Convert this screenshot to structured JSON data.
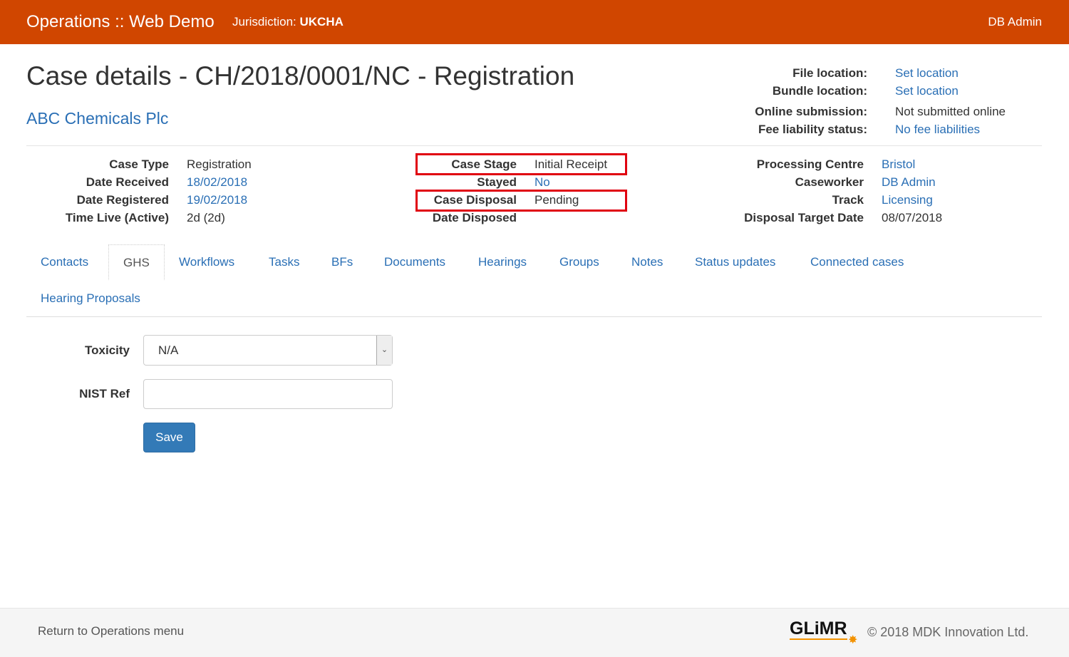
{
  "nav": {
    "brand": "Operations :: Web Demo",
    "jurisdiction_label": "Jurisdiction:",
    "jurisdiction": "UKCHA",
    "user": "DB Admin"
  },
  "title": "Case details - CH/2018/0001/NC - Registration",
  "company": "ABC Chemicals Plc",
  "top_right": [
    {
      "label": "File location:",
      "value": "Set location",
      "link": true
    },
    {
      "label": "Bundle location:",
      "value": "Set location",
      "link": true
    },
    {
      "label": "Online submission:",
      "value": "Not submitted online",
      "link": false
    },
    {
      "label": "Fee liability status:",
      "value": "No fee liabilities",
      "link": true
    }
  ],
  "col1": [
    {
      "label": "Case Type",
      "value": "Registration"
    },
    {
      "label": "Date Received",
      "value": "18/02/2018"
    },
    {
      "label": "Date Registered",
      "value": "19/02/2018"
    },
    {
      "label": "Time Live (Active)",
      "value": "2d (2d)"
    }
  ],
  "col2": [
    {
      "label": "Case Stage",
      "value": "Initial Receipt"
    },
    {
      "label": "Stayed",
      "value": "No"
    },
    {
      "label": "Case Disposal",
      "value": "Pending"
    },
    {
      "label": "Date Disposed",
      "value": ""
    }
  ],
  "col3": [
    {
      "label": "Processing Centre",
      "value": "Bristol"
    },
    {
      "label": "Caseworker",
      "value": "DB Admin"
    },
    {
      "label": "Track",
      "value": "Licensing"
    },
    {
      "label": "Disposal Target Date",
      "value": "08/07/2018"
    }
  ],
  "tabs": [
    "Contacts",
    "GHS",
    "Workflows",
    "Tasks",
    "BFs",
    "Documents",
    "Hearings",
    "Groups",
    "Notes",
    "Status updates",
    "Connected cases",
    "Hearing Proposals"
  ],
  "form": {
    "toxicity_label": "Toxicity",
    "toxicity_value": "N/A",
    "nist_label": "NIST Ref",
    "nist_value": "",
    "save": "Save"
  },
  "footer": {
    "return": "Return to Operations menu",
    "logo": "GLiMR",
    "copyright": "© 2018 MDK Innovation Ltd."
  },
  "colors": {
    "nav": "#d04600",
    "link": "#2a6fb5",
    "highlight": "#e00010"
  }
}
